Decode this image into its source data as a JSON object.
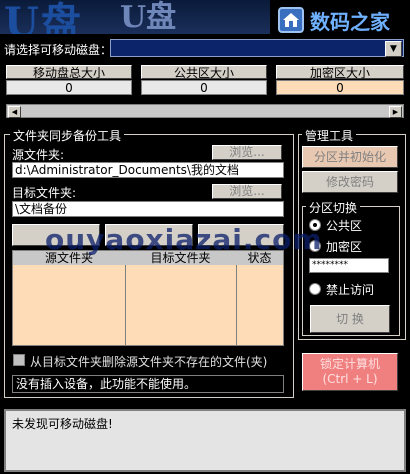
{
  "header": {
    "brand_text": "数码之家"
  },
  "drive": {
    "prompt_label": "请选择可移动磁盘：",
    "selected": ""
  },
  "sizes": [
    {
      "label": "移动盘总大小",
      "value": "0"
    },
    {
      "label": "公共区大小",
      "value": "0"
    },
    {
      "label": "加密区大小",
      "value": "0"
    }
  ],
  "sync": {
    "group_title": "文件夹同步备份工具",
    "source_label": "源文件夹:",
    "source_path": "d:\\Administrator_Documents\\我的文档",
    "target_label": "目标文件夹:",
    "target_path": "\\文档备份",
    "browse_label": "浏览...",
    "table_headers": [
      "源文件夹",
      "目标文件夹",
      "状态"
    ],
    "delete_checkbox_label": "从目标文件夹删除源文件夹不存在的文件(夹)",
    "status_text": "没有插入设备，此功能不能使用。"
  },
  "manage": {
    "group_title": "管理工具",
    "partition_init_label": "分区并初始化",
    "change_password_label": "修改密码",
    "switch_group_title": "分区切换",
    "public_label": "公共区",
    "encrypted_label": "加密区",
    "password_mask": "********",
    "deny_label": "禁止访问",
    "switch_label": "切 换"
  },
  "lock_button_label_line1": "锁定计算机",
  "lock_button_label_line2": "(Ctrl + L)",
  "message": "未发现可移动磁盘!",
  "watermark": "ouyaoxiazai.com",
  "colors": {
    "select_bg": "#0b246a",
    "table_bg": "#ffdcb8",
    "lock_button_bg": "#f08080",
    "accent_blue": "#6fb0ff"
  }
}
